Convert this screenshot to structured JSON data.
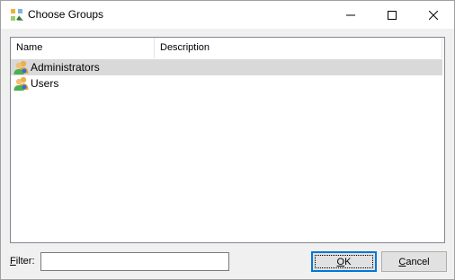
{
  "window": {
    "title": "Choose Groups",
    "app_icon": "choose-groups-icon",
    "caption_buttons": {
      "minimize": "minimize-icon",
      "maximize": "maximize-icon",
      "close": "close-icon"
    }
  },
  "list": {
    "columns": [
      "Name",
      "Description"
    ],
    "rows": [
      {
        "name": "Administrators",
        "description": "",
        "icon": "group-icon",
        "selected": true
      },
      {
        "name": "Users",
        "description": "",
        "icon": "group-icon",
        "selected": false
      }
    ]
  },
  "filter": {
    "label_prefix": "F",
    "label_rest": "ilter:",
    "value": "",
    "placeholder": ""
  },
  "buttons": {
    "ok_prefix": "O",
    "ok_rest": "K",
    "cancel_prefix": "C",
    "cancel_rest": "ancel"
  },
  "colors": {
    "selection": "#d9d9d9",
    "focus_border": "#0078d7",
    "dialog_bg": "#f0f0f0"
  }
}
